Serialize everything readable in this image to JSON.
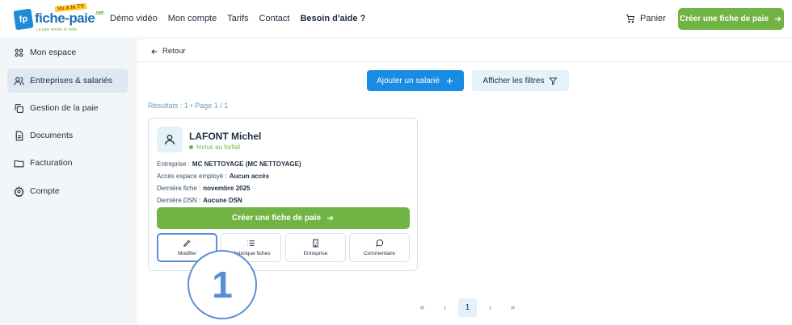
{
  "logo": {
    "mark": "fp",
    "name": "fiche-paie",
    "badge": "Vu à la TV",
    "suffix": ".net",
    "tagline": "La paie simple et nette"
  },
  "nav": {
    "items": [
      "Démo vidéo",
      "Mon compte",
      "Tarifs",
      "Contact"
    ],
    "help": "Besoin d'aide ?",
    "cart_label": "Panier",
    "cta_label": "Créer une fiche de paie"
  },
  "sidebar": {
    "items": [
      {
        "label": "Mon espace",
        "icon": "grid-icon"
      },
      {
        "label": "Entreprises & salariés",
        "icon": "users-icon"
      },
      {
        "label": "Gestion de la paie",
        "icon": "copy-icon"
      },
      {
        "label": "Documents",
        "icon": "document-icon"
      },
      {
        "label": "Facturation",
        "icon": "folder-icon"
      },
      {
        "label": "Compte",
        "icon": "gear-icon"
      }
    ],
    "active_index": 1
  },
  "main": {
    "back_label": "Retour",
    "add_employee_label": "Ajouter un salarié",
    "filters_label": "Afficher les filtres",
    "results_text": "Résultats : 1  • Page 1 / 1"
  },
  "employee_card": {
    "name": "LAFONT Michel",
    "status": "Inclus au forfait",
    "rows": [
      {
        "label": "Entreprise :",
        "value": "MC NETTOYAGE (MC NETTOYAGE)"
      },
      {
        "label": "Accès espace employé :",
        "value": "Aucun accès"
      },
      {
        "label": "Dernière fiche :",
        "value": "novembre 2025"
      },
      {
        "label": "Dernière DSN :",
        "value": "Aucune DSN"
      }
    ],
    "cta_label": "Créer une fiche de paie",
    "actions": [
      {
        "label": "Modifier",
        "icon": "pencil-icon"
      },
      {
        "label": "Historique fiches",
        "icon": "list-icon"
      },
      {
        "label": "Entreprise",
        "icon": "building-icon"
      },
      {
        "label": "Commentaire",
        "icon": "comment-icon"
      }
    ]
  },
  "step_marker": "1",
  "pagination": {
    "first": "«",
    "prev": "‹",
    "current": "1",
    "next": "›",
    "last": "»"
  },
  "colors": {
    "green": "#72b444",
    "blue": "#1a8be3",
    "highlight": "#5b8fd4",
    "sidebar_bg": "#f3f6f8"
  }
}
